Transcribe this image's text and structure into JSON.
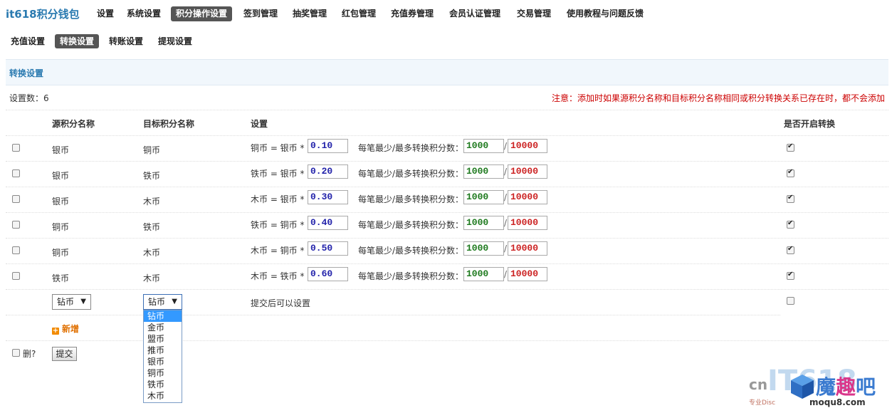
{
  "brand": "it618积分钱包",
  "top_nav": [
    {
      "label": "设置",
      "active": false
    },
    {
      "label": "系统设置",
      "active": false
    },
    {
      "label": "积分操作设置",
      "active": true
    },
    {
      "label": "签到管理",
      "active": false
    },
    {
      "label": "抽奖管理",
      "active": false
    },
    {
      "label": "红包管理",
      "active": false
    },
    {
      "label": "充值券管理",
      "active": false
    },
    {
      "label": "会员认证管理",
      "active": false
    },
    {
      "label": "交易管理",
      "active": false
    },
    {
      "label": "使用教程与问题反馈",
      "active": false
    }
  ],
  "sub_nav": [
    {
      "label": "充值设置",
      "active": false
    },
    {
      "label": "转换设置",
      "active": true
    },
    {
      "label": "转账设置",
      "active": false
    },
    {
      "label": "提现设置",
      "active": false
    }
  ],
  "section_title": "转换设置",
  "count_text": "设置数：6",
  "notice": "注意：添加时如果源积分名称和目标积分名称相同或积分转换关系已存在时，都不会添加",
  "headers": {
    "source": "源积分名称",
    "target": "目标积分名称",
    "settings": "设置",
    "enabled": "是否开启转换"
  },
  "formula_suffix": "*",
  "min_max_label": "每笔最少/最多转换积分数：",
  "rows": [
    {
      "source": "银币",
      "target": "铜币",
      "formula": "铜币 = 银币",
      "rate": "0.10",
      "min": "1000",
      "max": "10000",
      "enabled": true,
      "selected": false
    },
    {
      "source": "银币",
      "target": "铁币",
      "formula": "铁币 = 银币",
      "rate": "0.20",
      "min": "1000",
      "max": "10000",
      "enabled": true,
      "selected": false
    },
    {
      "source": "银币",
      "target": "木币",
      "formula": "木币 = 银币",
      "rate": "0.30",
      "min": "1000",
      "max": "10000",
      "enabled": true,
      "selected": false
    },
    {
      "source": "铜币",
      "target": "铁币",
      "formula": "铁币 = 铜币",
      "rate": "0.40",
      "min": "1000",
      "max": "10000",
      "enabled": true,
      "selected": false
    },
    {
      "source": "铜币",
      "target": "木币",
      "formula": "木币 = 铜币",
      "rate": "0.50",
      "min": "1000",
      "max": "10000",
      "enabled": true,
      "selected": false
    },
    {
      "source": "铁币",
      "target": "木币",
      "formula": "木币 = 铁币",
      "rate": "0.60",
      "min": "1000",
      "max": "10000",
      "enabled": true,
      "selected": false
    }
  ],
  "new_row": {
    "source_value": "钻币",
    "target_value": "钻币",
    "settings_text": "提交后可以设置",
    "enabled": false
  },
  "dropdown_options": [
    "钻币",
    "金币",
    "盟币",
    "推币",
    "银币",
    "铜币",
    "铁币",
    "木币"
  ],
  "dropdown_selected_index": 0,
  "add_label": "新增",
  "delete_label": "删?",
  "submit_label": "提交",
  "watermark": {
    "prefix": "cn",
    "it_text": "IT618",
    "name_a": "魔",
    "name_b": "趣",
    "name_c": "吧",
    "tagline": "专业Disc",
    "domain": "moqu8.com"
  }
}
